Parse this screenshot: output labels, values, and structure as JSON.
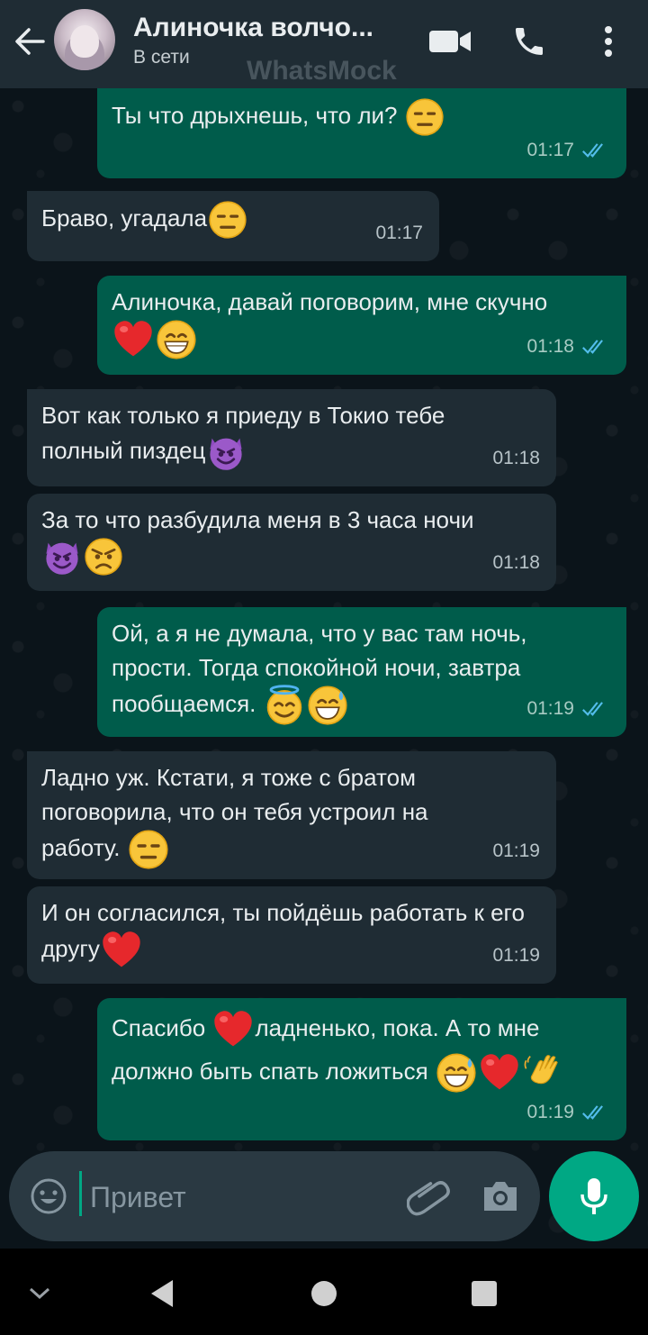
{
  "header": {
    "contact_name": "Алиночка волчо...",
    "status": "В сети",
    "watermark": "WhatsMock",
    "icons": [
      "back-arrow-icon",
      "video-call-icon",
      "phone-icon",
      "more-vert-icon"
    ]
  },
  "messages": [
    {
      "dir": "out",
      "text": "Ты что дрыхнешь, что ли?",
      "emojis": [
        "expressionless"
      ],
      "time": "01:17",
      "read": true
    },
    {
      "dir": "in",
      "text": "Браво, угадала",
      "emojis": [
        "expressionless"
      ],
      "time": "01:17"
    },
    {
      "dir": "out",
      "text": "Алиночка, давай поговорим, мне скучно",
      "emojis": [
        "red-heart",
        "grin"
      ],
      "time": "01:18",
      "read": true
    },
    {
      "dir": "in",
      "text": "Вот как только я приеду в Токио тебе полный пиздец",
      "emojis": [
        "smiling-devil"
      ],
      "time": "01:18"
    },
    {
      "dir": "in",
      "text": "За то что разбудила меня в 3 часа ночи",
      "emojis": [
        "smiling-devil",
        "angry"
      ],
      "time": "01:18"
    },
    {
      "dir": "out",
      "text": "Ой, а я не думала, что у вас там ночь, прости. Тогда спокойной ночи, завтра пообщаемся.",
      "emojis": [
        "halo",
        "sweat-smile"
      ],
      "time": "01:19",
      "read": true
    },
    {
      "dir": "in",
      "text": "Ладно уж. Кстати, я тоже с братом поговорила, что он тебя устроил на работу.",
      "emojis": [
        "expressionless"
      ],
      "time": "01:19"
    },
    {
      "dir": "in",
      "text": "И он согласился, ты пойдёшь работать к его другу",
      "emojis": [
        "red-heart"
      ],
      "time": "01:19"
    },
    {
      "dir": "out",
      "text_a": "Спасибо",
      "text_b": "ладненько, пока. А то мне должно быть спать ложиться",
      "emojis": [
        "red-heart",
        "sweat-smile",
        "red-heart",
        "waving-hand"
      ],
      "time": "01:19",
      "read": true
    }
  ],
  "composer": {
    "placeholder": "Привет",
    "icons": [
      "emoji-icon",
      "attach-icon",
      "camera-icon",
      "mic-icon"
    ]
  },
  "colors": {
    "header_bg": "#1f2c34",
    "chat_bg": "#0b141a",
    "incoming_bubble": "#1f2c34",
    "outgoing_bubble": "#005c4b",
    "accent": "#00a884",
    "read_tick": "#53bdeb"
  },
  "navbar": {
    "icons": [
      "chevron-down-icon",
      "back-triangle-icon",
      "home-circle-icon",
      "recents-square-icon"
    ]
  }
}
